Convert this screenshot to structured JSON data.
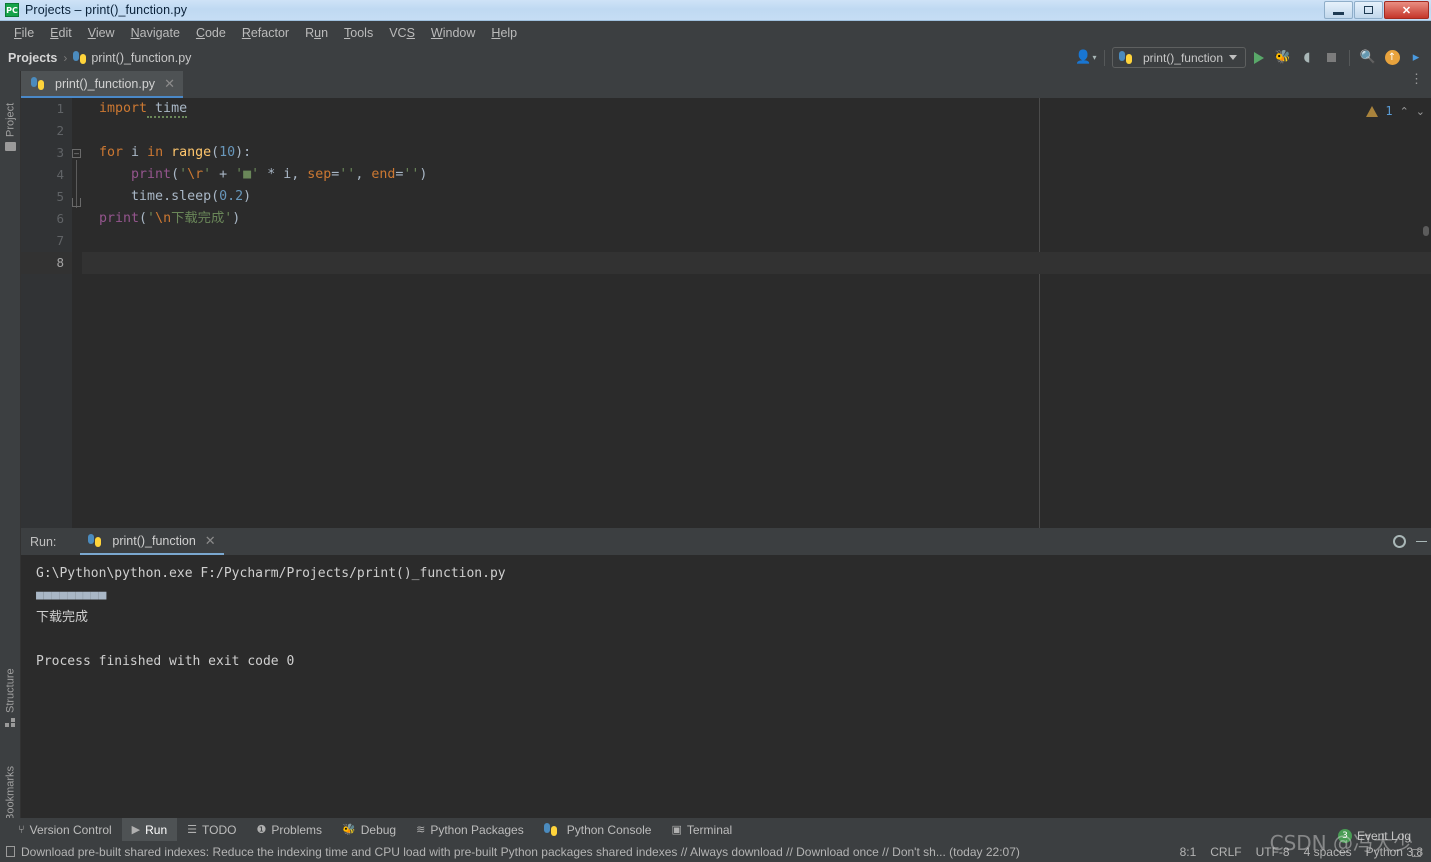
{
  "window": {
    "title": "Projects – print()_function.py",
    "app_icon": "pycharm-icon",
    "controls": {
      "minimize": "–",
      "restore": "❐",
      "close": "✕"
    }
  },
  "menubar": {
    "items": [
      {
        "label": "File",
        "mnemonic": "F"
      },
      {
        "label": "Edit",
        "mnemonic": "E"
      },
      {
        "label": "View",
        "mnemonic": "V"
      },
      {
        "label": "Navigate",
        "mnemonic": "N"
      },
      {
        "label": "Code",
        "mnemonic": "C"
      },
      {
        "label": "Refactor",
        "mnemonic": "R"
      },
      {
        "label": "Run",
        "mnemonic": "u"
      },
      {
        "label": "Tools",
        "mnemonic": "T"
      },
      {
        "label": "VCS",
        "mnemonic": "S"
      },
      {
        "label": "Window",
        "mnemonic": "W"
      },
      {
        "label": "Help",
        "mnemonic": "H"
      }
    ]
  },
  "navbar": {
    "breadcrumb": [
      "Projects",
      "print()_function.py"
    ],
    "separator": "›",
    "run_config": {
      "name": "print()_function",
      "icon": "python-icon"
    },
    "actions": [
      {
        "name": "user-account-icon",
        "glyph": "\u0000"
      },
      {
        "name": "run-button",
        "glyph": "▶"
      },
      {
        "name": "debug-button",
        "glyph": "🐞"
      },
      {
        "name": "run-coverage-button",
        "glyph": "◑"
      },
      {
        "name": "stop-button",
        "glyph": "■"
      },
      {
        "name": "search-icon",
        "glyph": "🔍"
      },
      {
        "name": "updates-icon",
        "glyph": "↑"
      },
      {
        "name": "ai-assistant-icon",
        "glyph": "▶"
      }
    ]
  },
  "left_tool_strip": {
    "items": [
      {
        "label": "Project",
        "icon": "folder-icon"
      },
      {
        "label": "Structure",
        "icon": "structure-icon"
      },
      {
        "label": "Bookmarks",
        "icon": "bookmark-icon"
      }
    ]
  },
  "editor": {
    "tab": {
      "label": "print()_function.py",
      "icon": "python-file-icon",
      "close": "✕"
    },
    "warning": {
      "count": "1",
      "icon": "warning-triangle-icon"
    },
    "nav_up": "⌃",
    "nav_down": "⌄",
    "line_numbers": [
      "1",
      "2",
      "3",
      "4",
      "5",
      "6",
      "7",
      "8"
    ],
    "code_lines": [
      {
        "n": 1,
        "text": "import time"
      },
      {
        "n": 2,
        "text": ""
      },
      {
        "n": 3,
        "text": "for i in range(10):"
      },
      {
        "n": 4,
        "text": "    print('\\r' + '■' * i, sep='', end='')"
      },
      {
        "n": 5,
        "text": "    time.sleep(0.2)"
      },
      {
        "n": 6,
        "text": "print('\\n下载完成')"
      },
      {
        "n": 7,
        "text": ""
      },
      {
        "n": 8,
        "text": ""
      }
    ],
    "tokens": {
      "l1_kw": "import",
      "l1_mod": " time",
      "l3_kw": "for",
      "l3_var": " i ",
      "l3_in": "in",
      "l3_fn": " range",
      "l3_p1": "(",
      "l3_num": "10",
      "l3_p2": "):",
      "l4_fn": "print",
      "l4_p1": "(",
      "l4_s1": "'",
      "l4_esc": "\\r",
      "l4_s2": "'",
      "l4_plus": " + ",
      "l4_s3": "'■'",
      "l4_mul": " * ",
      "l4_var": "i",
      "l4_comma1": ", ",
      "l4_kwsep": "sep",
      "l4_eq1": "=",
      "l4_emp1": "''",
      "l4_comma2": ", ",
      "l4_kwend": "end",
      "l4_eq2": "=",
      "l4_emp2": "''",
      "l4_p2": ")",
      "l5_mod": "time",
      "l5_dot": ".",
      "l5_fn": "sleep",
      "l5_p1": "(",
      "l5_num": "0.2",
      "l5_p2": ")",
      "l6_fn": "print",
      "l6_p1": "(",
      "l6_s1": "'",
      "l6_esc": "\\n",
      "l6_s2": "下载完成'",
      "l6_p2": ")"
    }
  },
  "run_window": {
    "label": "Run:",
    "tab": {
      "name": "print()_function",
      "icon": "python-icon",
      "close": "✕"
    },
    "tools": [
      {
        "name": "settings-gear-icon",
        "glyph": "⚙"
      },
      {
        "name": "hide-window-icon",
        "glyph": "—"
      }
    ],
    "console_lines": [
      "G:\\Python\\python.exe F:/Pycharm/Projects/print()_function.py",
      "■■■■■■■■■",
      "下载完成",
      "",
      "Process finished with exit code 0"
    ]
  },
  "bottom_tabs": {
    "items": [
      {
        "label": "Version Control",
        "icon": "branch-icon",
        "active": false
      },
      {
        "label": "Run",
        "icon": "play-icon",
        "active": true
      },
      {
        "label": "TODO",
        "icon": "list-icon",
        "active": false
      },
      {
        "label": "Problems",
        "icon": "warning-icon",
        "active": false
      },
      {
        "label": "Debug",
        "icon": "bug-icon",
        "active": false
      },
      {
        "label": "Python Packages",
        "icon": "layers-icon",
        "active": false
      },
      {
        "label": "Python Console",
        "icon": "python-icon",
        "active": false
      },
      {
        "label": "Terminal",
        "icon": "terminal-icon",
        "active": false
      }
    ]
  },
  "statusbar": {
    "message": "Download pre-built shared indexes: Reduce the indexing time and CPU load with pre-built Python packages shared indexes // Always download // Download once // Don't sh... (today 22:07)",
    "caret_position": "8:1",
    "line_separator": "CRLF",
    "encoding": "UTF-8",
    "indent": "4 spaces",
    "interpreter": "Python 3.8",
    "event_log": {
      "label": "Event Log",
      "count": "3"
    }
  },
  "watermark": "CSDN @冯大少"
}
